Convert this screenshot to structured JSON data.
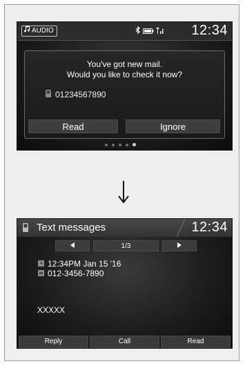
{
  "screen1": {
    "audio_label": "AUDIO",
    "time": "12:34",
    "dialog": {
      "line1": "You've got new mail.",
      "line2": "Would you like to check it now?",
      "sender": "01234567890",
      "read_label": "Read",
      "ignore_label": "Ignore"
    },
    "page_dots": {
      "count": 5,
      "active": 5
    }
  },
  "screen2": {
    "title": "Text messages",
    "time": "12:34",
    "page": "1/3",
    "timestamp": "12:34PM Jan 15 '16",
    "sender": "012-3456-7890",
    "body": "XXXXX",
    "buttons": [
      "Reply",
      "Call",
      "Read"
    ]
  },
  "icons": [
    "music-note-icon",
    "bluetooth-icon",
    "battery-icon",
    "signal-icon",
    "phone-icon",
    "prev-arrow-icon",
    "next-arrow-icon",
    "clock-icon",
    "contact-icon",
    "down-arrow-icon"
  ]
}
